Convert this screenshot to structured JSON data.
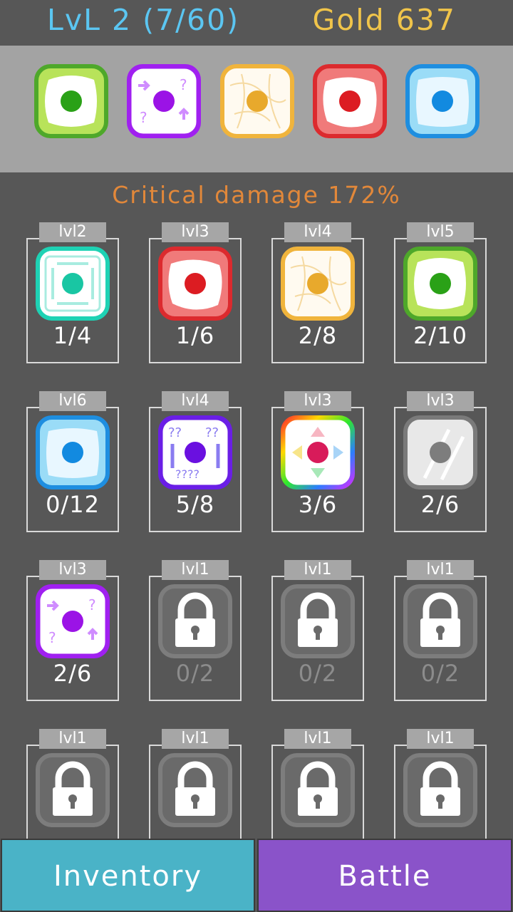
{
  "header": {
    "level_text": "LvL 2 (7/60)",
    "gold_text": "Gold 637"
  },
  "equipped": [
    {
      "type": "green",
      "color": "#63c43a",
      "dot": "#2aa117",
      "inner": "#ffffff"
    },
    {
      "type": "purple",
      "color": "#a020f0",
      "dot": "#9b13e6",
      "inner": "#ffffff"
    },
    {
      "type": "yellow",
      "color": "#f0b43c",
      "dot": "#e8a92c",
      "inner": "#fffaf0"
    },
    {
      "type": "red",
      "color": "#e6373a",
      "dot": "#dc1c22",
      "inner": "#ffffff"
    },
    {
      "type": "blue",
      "color": "#1e9ce6",
      "dot": "#128ae0",
      "inner": "#e3f5ff"
    }
  ],
  "stats": {
    "critical_text": "Critical damage 172%"
  },
  "cards": [
    {
      "level": "lvl2",
      "count": "1/4",
      "die": "teal",
      "locked": false
    },
    {
      "level": "lvl3",
      "count": "1/6",
      "die": "red",
      "locked": false
    },
    {
      "level": "lvl4",
      "count": "2/8",
      "die": "yellow",
      "locked": false
    },
    {
      "level": "lvl5",
      "count": "2/10",
      "die": "green",
      "locked": false
    },
    {
      "level": "lvl6",
      "count": "0/12",
      "die": "blue",
      "locked": false
    },
    {
      "level": "lvl4",
      "count": "5/8",
      "die": "violet",
      "locked": false
    },
    {
      "level": "lvl3",
      "count": "3/6",
      "die": "rainbow",
      "locked": false
    },
    {
      "level": "lvl3",
      "count": "2/6",
      "die": "grey",
      "locked": false
    },
    {
      "level": "lvl3",
      "count": "2/6",
      "die": "purple",
      "locked": false
    },
    {
      "level": "lvl1",
      "count": "0/2",
      "die": "lock",
      "locked": true
    },
    {
      "level": "lvl1",
      "count": "0/2",
      "die": "lock",
      "locked": true
    },
    {
      "level": "lvl1",
      "count": "0/2",
      "die": "lock",
      "locked": true
    },
    {
      "level": "lvl1",
      "count": "",
      "die": "lock",
      "locked": true
    },
    {
      "level": "lvl1",
      "count": "",
      "die": "lock",
      "locked": true
    },
    {
      "level": "lvl1",
      "count": "",
      "die": "lock",
      "locked": true
    },
    {
      "level": "lvl1",
      "count": "",
      "die": "lock",
      "locked": true
    }
  ],
  "buttons": {
    "inventory": "Inventory",
    "battle": "Battle"
  },
  "colors": {
    "teal": "#1ed2b4",
    "red": "#e6373a",
    "yellow": "#f0b43c",
    "green": "#63c43a",
    "blue": "#1e9ce6",
    "violet": "#6a1ee6",
    "purple": "#a020f0",
    "grey": "#8a8a8a"
  }
}
